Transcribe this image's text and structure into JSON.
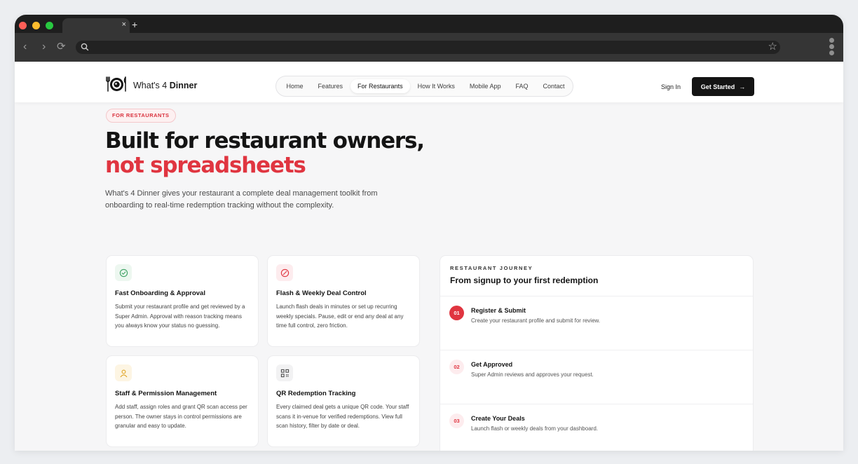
{
  "browser": {
    "tab_close": "×",
    "new_tab": "+",
    "back": "‹",
    "forward": "›",
    "reload": "⟳",
    "star": "☆"
  },
  "header": {
    "logo_prefix": "What's 4",
    "logo_bold": "Dinner",
    "nav": [
      "Home",
      "Features",
      "For Restaurants",
      "How It Works",
      "Mobile App",
      "FAQ",
      "Contact"
    ],
    "active_nav": "For Restaurants",
    "sign_in": "Sign In",
    "cta": "Get Started",
    "cta_arrow": "→"
  },
  "hero": {
    "eyebrow": "FOR RESTAURANTS",
    "title_line1": "Built for restaurant owners,",
    "title_line2": "not spreadsheets",
    "subtitle": "What's 4 Dinner gives your restaurant a complete deal management toolkit from onboarding to real-time redemption tracking without the complexity."
  },
  "features": [
    {
      "title": "Fast Onboarding & Approval",
      "desc": "Submit your restaurant profile and get reviewed by a Super Admin. Approval with reason tracking means you always know your status no guessing.",
      "icon": "check-circle-icon",
      "icon_color": "#3fa365",
      "icon_bg": "#edf7f0"
    },
    {
      "title": "Flash & Weekly Deal Control",
      "desc": "Launch flash deals in minutes or set up recurring weekly specials. Pause, edit or end any deal at any time full control, zero friction.",
      "icon": "slash-circle-icon",
      "icon_color": "#e03540",
      "icon_bg": "#fdecee"
    },
    {
      "title": "Staff & Permission Management",
      "desc": "Add staff, assign roles and grant QR scan access per person. The owner stays in control permissions are granular and easy to update.",
      "icon": "user-icon",
      "icon_color": "#e0a526",
      "icon_bg": "#fdf5e3"
    },
    {
      "title": "QR Redemption Tracking",
      "desc": "Every claimed deal gets a unique QR code. Your staff scans it in-venue for verified redemptions. View full scan history, filter by date or deal.",
      "icon": "qr-code-icon",
      "icon_color": "#444444",
      "icon_bg": "#f2f2f3"
    }
  ],
  "journey": {
    "eyebrow": "RESTAURANT JOURNEY",
    "title": "From signup to your first redemption",
    "steps": [
      {
        "num": "01",
        "title": "Register & Submit",
        "desc": "Create your restaurant profile and submit for review.",
        "state": "done"
      },
      {
        "num": "02",
        "title": "Get Approved",
        "desc": "Super Admin reviews and approves your request.",
        "state": "todo"
      },
      {
        "num": "03",
        "title": "Create Your Deals",
        "desc": "Launch flash or weekly deals from your dashboard.",
        "state": "todo"
      }
    ]
  },
  "colors": {
    "accent": "#e03540",
    "dark": "#141414"
  }
}
